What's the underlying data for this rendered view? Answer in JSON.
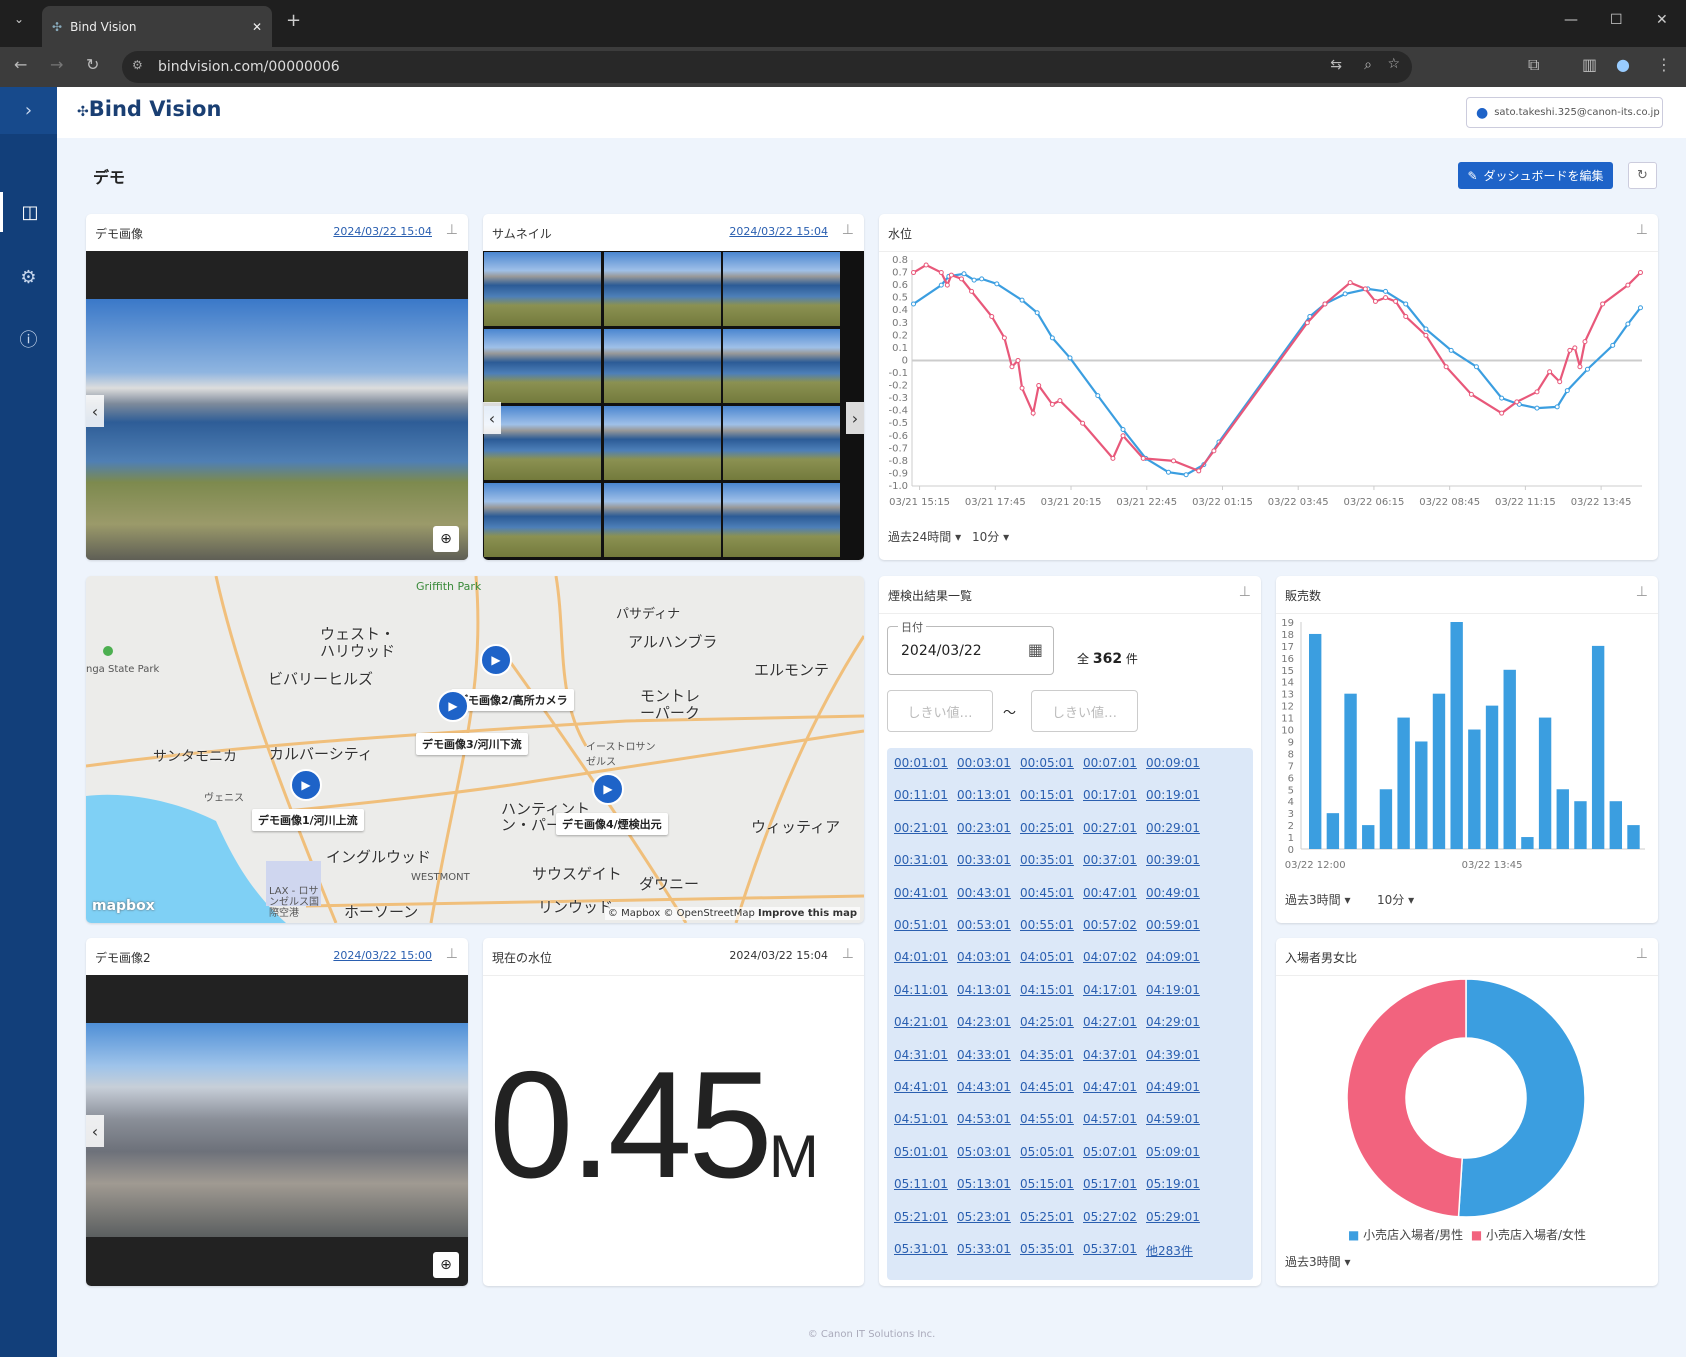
{
  "browser": {
    "tab_title": "Bind Vision",
    "url": "bindvision.com/00000006"
  },
  "header": {
    "logo": "Bind Vision",
    "user_email": "sato.takeshi.325@canon-its.co.jp"
  },
  "page": {
    "title": "デモ",
    "edit_button": "ダッシュボードを編集"
  },
  "cards": {
    "demo_image": {
      "title": "デモ画像",
      "date": "2024/03/22 15:04"
    },
    "thumbnail": {
      "title": "サムネイル",
      "date": "2024/03/22 15:04"
    },
    "water_level": {
      "title": "水位",
      "range": "過去24時間",
      "interval": "10分"
    },
    "map": {
      "places": [
        "Griffith Park",
        "パサディナ",
        "ウェスト・ハリウッド",
        "アルハンブラ",
        "ビバリーヒルズ",
        "エルモンテ",
        "モントレーパーク",
        "サンタモニカ",
        "カルバーシティ",
        "イーストロサンゼルス",
        "ヴェニス",
        "ハンティントン・パーク",
        "ウィッティア",
        "イングルウッド",
        "サウスゲイト",
        "ダウニー",
        "WESTMONT",
        "LAX - ロサンゼルス国際空港",
        "ホーソーン",
        "リンウッド",
        "nga State Park"
      ],
      "markers": [
        "デモ画像1/河川上流",
        "デモ画像2/高所カメラ",
        "デモ画像3/河川下流",
        "デモ画像4/煙検出元"
      ],
      "logo": "mapbox",
      "attribution": "© Mapbox © OpenStreetMap",
      "improve": "Improve this map"
    },
    "smoke": {
      "title": "煙検出結果一覧",
      "date_label": "日付",
      "date_value": "2024/03/22",
      "total_prefix": "全",
      "total": "362",
      "total_suffix": "件",
      "threshold_placeholder": "しきい値…",
      "tilde": "～",
      "times": [
        "00:01:01",
        "00:03:01",
        "00:05:01",
        "00:07:01",
        "00:09:01",
        "00:11:01",
        "00:13:01",
        "00:15:01",
        "00:17:01",
        "00:19:01",
        "00:21:01",
        "00:23:01",
        "00:25:01",
        "00:27:01",
        "00:29:01",
        "00:31:01",
        "00:33:01",
        "00:35:01",
        "00:37:01",
        "00:39:01",
        "00:41:01",
        "00:43:01",
        "00:45:01",
        "00:47:01",
        "00:49:01",
        "00:51:01",
        "00:53:01",
        "00:55:01",
        "00:57:02",
        "00:59:01",
        "04:01:01",
        "04:03:01",
        "04:05:01",
        "04:07:02",
        "04:09:01",
        "04:11:01",
        "04:13:01",
        "04:15:01",
        "04:17:01",
        "04:19:01",
        "04:21:01",
        "04:23:01",
        "04:25:01",
        "04:27:01",
        "04:29:01",
        "04:31:01",
        "04:33:01",
        "04:35:01",
        "04:37:01",
        "04:39:01",
        "04:41:01",
        "04:43:01",
        "04:45:01",
        "04:47:01",
        "04:49:01",
        "04:51:01",
        "04:53:01",
        "04:55:01",
        "04:57:01",
        "04:59:01",
        "05:01:01",
        "05:03:01",
        "05:05:01",
        "05:07:01",
        "05:09:01",
        "05:11:01",
        "05:13:01",
        "05:15:01",
        "05:17:01",
        "05:19:01",
        "05:21:01",
        "05:23:01",
        "05:25:01",
        "05:27:02",
        "05:29:01",
        "05:31:01",
        "05:33:01",
        "05:35:01",
        "05:37:01"
      ],
      "more": "他283件"
    },
    "sales": {
      "title": "販売数",
      "range": "過去3時間",
      "interval": "10分"
    },
    "demo_image2": {
      "title": "デモ画像2",
      "date": "2024/03/22 15:00"
    },
    "current_level": {
      "title": "現在の水位",
      "date": "2024/03/22 15:04",
      "value": "0.45",
      "unit": "M"
    },
    "gender": {
      "title": "入場者男女比",
      "range": "過去3時間"
    }
  },
  "footer": "© Canon IT Solutions Inc.",
  "colors": {
    "accent": "#1e63c8",
    "sidebar": "#123f7a",
    "blue_series": "#3b9ee0",
    "red_series": "#e8587a"
  },
  "chart_data": [
    {
      "type": "line",
      "title": "水位",
      "ylim": [
        -1.0,
        0.8
      ],
      "yticks": [
        "0.8",
        "0.7",
        "0.6",
        "0.5",
        "0.4",
        "0.3",
        "0.2",
        "0.1",
        "0",
        "-0.1",
        "-0.2",
        "-0.3",
        "-0.4",
        "-0.5",
        "-0.6",
        "-0.7",
        "-0.8",
        "-0.9",
        "-1.0"
      ],
      "xticks": [
        "03/21 15:15",
        "03/21 17:45",
        "03/21 20:15",
        "03/21 22:45",
        "03/22 01:15",
        "03/22 03:45",
        "03/22 06:15",
        "03/22 08:45",
        "03/22 11:15",
        "03/22 13:45"
      ],
      "series": [
        {
          "color": "#3b9ee0",
          "points": [
            [
              "03/21 15:03",
              0.45
            ],
            [
              "03/21 15:58",
              0.6
            ],
            [
              "03/21 16:13",
              0.67
            ],
            [
              "03/21 16:43",
              0.69
            ],
            [
              "03/21 17:03",
              0.64
            ],
            [
              "03/21 17:18",
              0.65
            ],
            [
              "03/21 17:48",
              0.61
            ],
            [
              "03/21 18:38",
              0.48
            ],
            [
              "03/21 19:08",
              0.38
            ],
            [
              "03/21 19:38",
              0.18
            ],
            [
              "03/21 20:13",
              0.02
            ],
            [
              "03/21 21:08",
              -0.28
            ],
            [
              "03/21 21:58",
              -0.55
            ],
            [
              "03/21 22:43",
              -0.78
            ],
            [
              "03/21 23:28",
              -0.89
            ],
            [
              "03/22 00:03",
              -0.91
            ],
            [
              "03/22 00:38",
              -0.83
            ],
            [
              "03/22 01:08",
              -0.65
            ],
            [
              "03/22 04:08",
              0.35
            ],
            [
              "03/22 04:38",
              0.45
            ],
            [
              "03/22 05:18",
              0.53
            ],
            [
              "03/22 06:03",
              0.57
            ],
            [
              "03/22 06:38",
              0.55
            ],
            [
              "03/22 07:18",
              0.45
            ],
            [
              "03/22 07:58",
              0.25
            ],
            [
              "03/22 08:48",
              0.08
            ],
            [
              "03/22 09:38",
              -0.05
            ],
            [
              "03/22 10:28",
              -0.3
            ],
            [
              "03/22 11:03",
              -0.35
            ],
            [
              "03/22 11:38",
              -0.38
            ],
            [
              "03/22 12:18",
              -0.37
            ],
            [
              "03/22 12:38",
              -0.24
            ],
            [
              "03/22 13:18",
              -0.07
            ],
            [
              "03/22 14:08",
              0.12
            ],
            [
              "03/22 14:38",
              0.29
            ],
            [
              "03/22 15:03",
              0.42
            ]
          ]
        },
        {
          "color": "#e8587a",
          "points": [
            [
              "03/21 15:03",
              0.7
            ],
            [
              "03/21 15:28",
              0.76
            ],
            [
              "03/21 15:58",
              0.7
            ],
            [
              "03/21 16:10",
              0.6
            ],
            [
              "03/21 16:18",
              0.68
            ],
            [
              "03/21 16:38",
              0.65
            ],
            [
              "03/21 16:58",
              0.55
            ],
            [
              "03/21 17:38",
              0.35
            ],
            [
              "03/21 18:03",
              0.18
            ],
            [
              "03/21 18:18",
              -0.05
            ],
            [
              "03/21 18:30",
              0.0
            ],
            [
              "03/21 18:38",
              -0.22
            ],
            [
              "03/21 19:00",
              -0.42
            ],
            [
              "03/21 19:11",
              -0.2
            ],
            [
              "03/21 19:38",
              -0.35
            ],
            [
              "03/21 19:53",
              -0.32
            ],
            [
              "03/21 20:38",
              -0.5
            ],
            [
              "03/21 21:38",
              -0.78
            ],
            [
              "03/21 21:58",
              -0.6
            ],
            [
              "03/21 22:38",
              -0.78
            ],
            [
              "03/21 23:38",
              -0.8
            ],
            [
              "03/22 00:28",
              -0.88
            ],
            [
              "03/22 00:58",
              -0.72
            ],
            [
              "03/22 04:03",
              0.3
            ],
            [
              "03/22 04:38",
              0.45
            ],
            [
              "03/22 05:28",
              0.62
            ],
            [
              "03/22 05:58",
              0.57
            ],
            [
              "03/22 06:18",
              0.47
            ],
            [
              "03/22 06:38",
              0.5
            ],
            [
              "03/22 06:58",
              0.47
            ],
            [
              "03/22 07:18",
              0.35
            ],
            [
              "03/22 07:58",
              0.2
            ],
            [
              "03/22 08:38",
              -0.05
            ],
            [
              "03/22 09:28",
              -0.27
            ],
            [
              "03/22 10:28",
              -0.42
            ],
            [
              "03/22 10:58",
              -0.33
            ],
            [
              "03/22 11:38",
              -0.25
            ],
            [
              "03/22 12:03",
              -0.09
            ],
            [
              "03/22 12:23",
              -0.17
            ],
            [
              "03/22 12:43",
              0.08
            ],
            [
              "03/22 12:53",
              0.1
            ],
            [
              "03/22 13:03",
              -0.05
            ],
            [
              "03/22 13:13",
              0.15
            ],
            [
              "03/22 13:48",
              0.45
            ],
            [
              "03/22 14:38",
              0.6
            ],
            [
              "03/22 15:03",
              0.7
            ]
          ]
        }
      ]
    },
    {
      "type": "bar",
      "title": "販売数",
      "ylim": [
        0,
        19
      ],
      "xticks": [
        "03/22 12:00",
        "03/22 13:45"
      ],
      "values": [
        18,
        3,
        13,
        2,
        5,
        11,
        9,
        13,
        19,
        10,
        12,
        15,
        1,
        11,
        5,
        4,
        17,
        4,
        2
      ],
      "color": "#3b9ee0"
    },
    {
      "type": "pie",
      "title": "入場者男女比",
      "donut": true,
      "slices": [
        {
          "name": "小売店入場者/男性",
          "value": 51,
          "color": "#3b9ee0"
        },
        {
          "name": "小売店入場者/女性",
          "value": 49,
          "color": "#f2637e"
        }
      ],
      "legend": "bottom"
    }
  ]
}
